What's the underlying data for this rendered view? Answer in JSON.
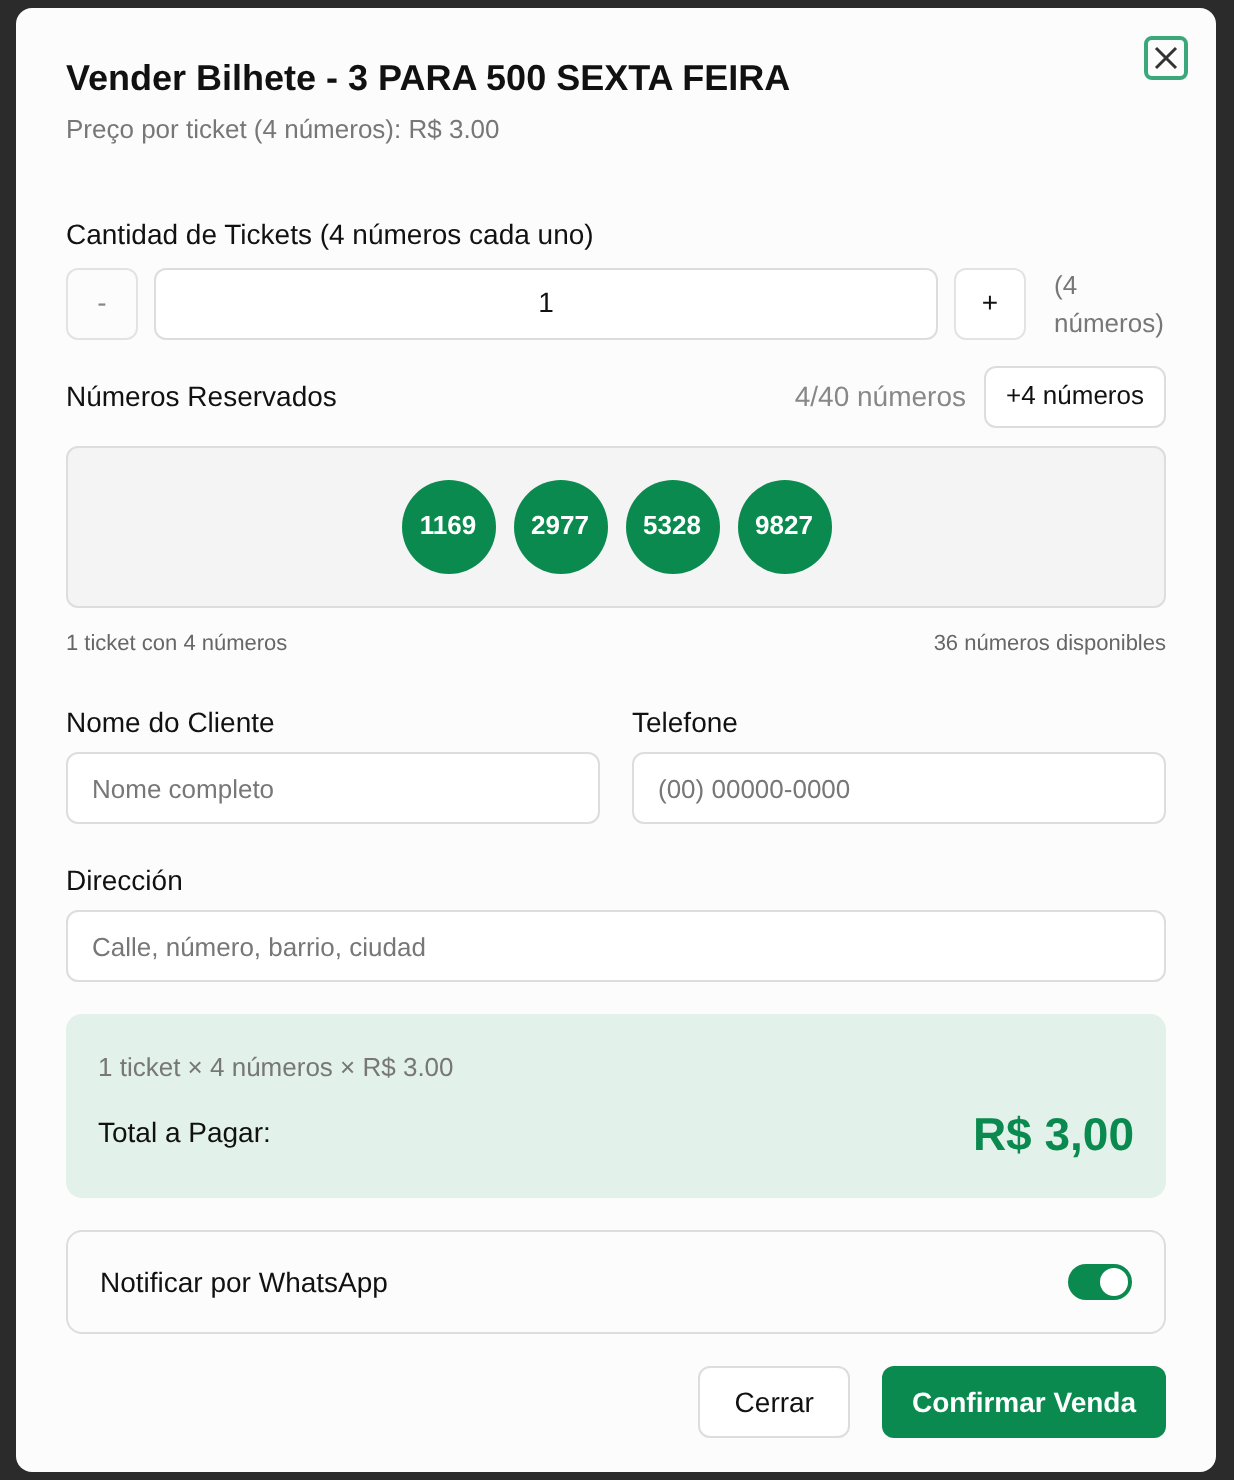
{
  "dialog": {
    "title": "Vender Bilhete - 3 PARA 500 SEXTA FEIRA",
    "subtitle": "Preço por ticket (4 números): R$ 3.00"
  },
  "quantity": {
    "label": "Cantidad de Tickets (4 números cada uno)",
    "minus": "-",
    "value": "1",
    "plus": "+",
    "note": "(4 números)"
  },
  "reserved": {
    "label": "Números Reservados",
    "count": "4/40 números",
    "add_button": "+4 números",
    "numbers": [
      "1169",
      "2977",
      "5328",
      "9827"
    ],
    "left_note": "1 ticket con 4 números",
    "right_note": "36 números disponibles"
  },
  "fields": [
    {
      "label": "Nome do Cliente",
      "placeholder": "Nome completo"
    },
    {
      "label": "Telefone",
      "placeholder": "(00) 00000-0000"
    },
    {
      "label": "Dirección",
      "placeholder": "Calle, número, barrio, ciudad"
    }
  ],
  "summary": {
    "formula": "1 ticket × 4 números × R$ 3.00",
    "total_label": "Total a Pagar:",
    "total": "R$ 3,00"
  },
  "whatsapp": {
    "label": "Notificar por WhatsApp",
    "on": true
  },
  "buttons": [
    {
      "label": "Cerrar",
      "kind": "secondary"
    },
    {
      "label": "Confirmar Venda",
      "kind": "primary"
    }
  ]
}
